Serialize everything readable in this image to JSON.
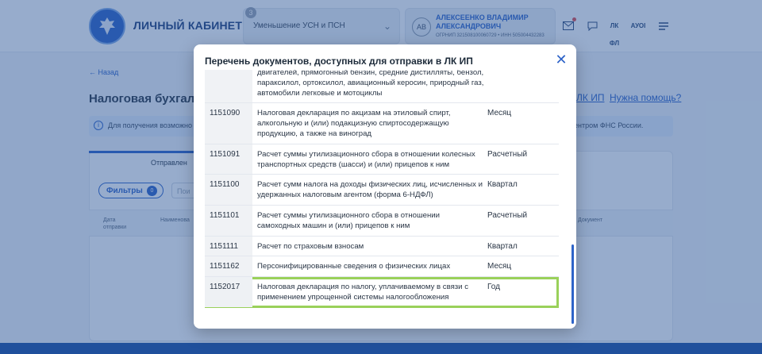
{
  "header": {
    "brand": "ЛИЧНЫЙ КАБИНЕТ ИП",
    "regime_badge": "3",
    "regime_text": "Уменьшение УСН и ПСН",
    "avatar_initials": "АВ",
    "user_name": "АЛЕКСЕЕНКО ВЛАДИМИР АЛЕКСАНДРОВИЧ",
    "user_ids": "ОГРНИП 321508100060729 • ИНН 505004432283",
    "fl_label": "ЛК ФЛ",
    "lang_label": "АУОІ"
  },
  "page": {
    "back_label": "Назад",
    "title": "Налоговая бухгалте",
    "link_lk_ip": "ЛК ИП",
    "link_help": "Нужна помощь?",
    "info_text_left": "Для получения возможно",
    "info_text_right": "центром ФНС России.",
    "tab_sent": "Отправлен",
    "filters_label": "Фильтры",
    "filters_count": "0",
    "search_stub": "Пои",
    "col_date": "Дата отправки",
    "col_name": "Наименова",
    "col_doc": "Документ"
  },
  "modal": {
    "title": "Перечень документов, доступных для отправки в ЛК ИП",
    "rows": [
      {
        "code": "",
        "description": "двигателей, прямогонный бензин, средние дистилляты, бензол, параксилол, ортоксилол, авиационный керосин, природный газ, автомобили легковые и мотоциклы",
        "period": ""
      },
      {
        "code": "1151090",
        "description": "Налоговая декларация по акцизам на этиловый спирт, алкогольную и (или) подакцизную спиртосодержащую продукцию, а также на виноград",
        "period": "Месяц"
      },
      {
        "code": "1151091",
        "description": "Расчет суммы утилизационного сбора в отношении колесных транспортных средств (шасси) и (или) прицепов к ним",
        "period": "Расчетный"
      },
      {
        "code": "1151100",
        "description": "Расчет сумм налога на доходы физических лиц, исчисленных и удержанных налоговым агентом (форма 6-НДФЛ)",
        "period": "Квартал"
      },
      {
        "code": "1151101",
        "description": "Расчет суммы утилизационного сбора в отношении самоходных машин и (или) прицепов к ним",
        "period": "Расчетный"
      },
      {
        "code": "1151111",
        "description": "Расчет по страховым взносам",
        "period": "Квартал"
      },
      {
        "code": "1151162",
        "description": "Персонифицированные сведения о физических лицах",
        "period": "Месяц"
      },
      {
        "code": "1152017",
        "description": "Налоговая декларация по налогу, уплачиваемому в связи с применением упрощенной системы налогообложения",
        "period": "Год"
      }
    ],
    "highlighted_code": "1152017"
  },
  "colors": {
    "accent": "#2d63c8",
    "highlight_outline": "#9ad15a",
    "overlay": "#265294"
  }
}
